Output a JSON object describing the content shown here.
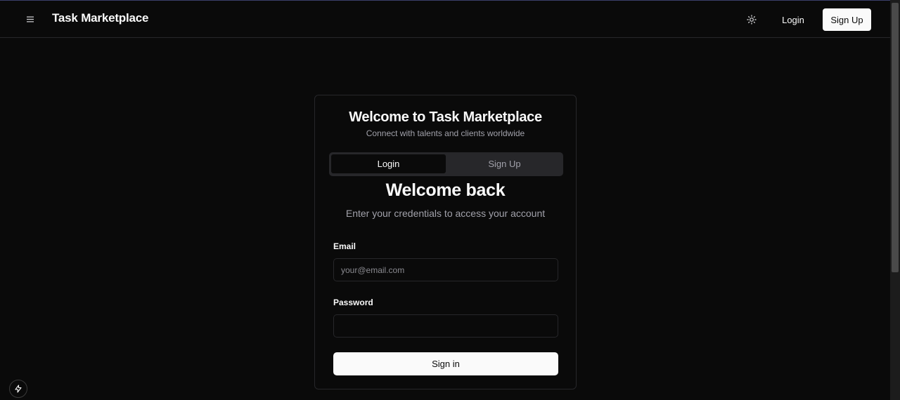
{
  "header": {
    "brand": "Task Marketplace",
    "menu_icon": "hamburger-menu-icon",
    "theme_icon": "sun-icon",
    "login_label": "Login",
    "signup_label": "Sign Up"
  },
  "card": {
    "title": "Welcome to Task Marketplace",
    "subtitle": "Connect with talents and clients worldwide",
    "tabs": [
      {
        "label": "Login",
        "active": true
      },
      {
        "label": "Sign Up",
        "active": false
      }
    ],
    "form": {
      "title": "Welcome back",
      "description": "Enter your credentials to access your account",
      "email_label": "Email",
      "email_placeholder": "your@email.com",
      "email_value": "",
      "password_label": "Password",
      "password_value": "",
      "submit_label": "Sign in"
    }
  },
  "dev_badge_icon": "lightning-bolt-icon",
  "colors": {
    "background": "#0a0a0a",
    "foreground": "#fafafa",
    "muted": "#a1a1aa",
    "border": "#27272a",
    "primary_button": "#fafafa"
  }
}
